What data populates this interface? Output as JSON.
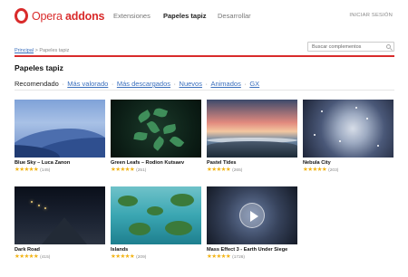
{
  "header": {
    "logo_part1": "Opera ",
    "logo_part2": "addons",
    "nav": [
      "Extensiones",
      "Papeles tapiz",
      "Desarrollar"
    ],
    "login": "INICIAR SESIÓN"
  },
  "breadcrumb": {
    "home": "Principal",
    "sep": " > ",
    "current": "Papeles tapiz"
  },
  "search": {
    "placeholder": "Buscar complementos"
  },
  "page_title": "Papeles tapiz",
  "tabs": [
    "Recomendado",
    "Más valorado",
    "Más descargados",
    "Nuevos",
    "Animados",
    "GX"
  ],
  "tab_separator": "·",
  "accent_color": "#d92b2b",
  "link_color": "#3a6fbd",
  "star_color": "#f2b417",
  "cards": [
    {
      "title": "Blue Sky – Luca Zanon",
      "stars": "★★★★★",
      "count": "(145)"
    },
    {
      "title": "Green Leafs – Rodion Kutsaev",
      "stars": "★★★★★",
      "count": "(251)"
    },
    {
      "title": "Pastel Tides",
      "stars": "★★★★★",
      "count": "(265)"
    },
    {
      "title": "Nebula City",
      "stars": "★★★★★",
      "count": "(203)"
    },
    {
      "title": "Dark Road",
      "stars": "★★★★★",
      "count": "(415)"
    },
    {
      "title": "Islands",
      "stars": "★★★★★",
      "count": "(209)"
    },
    {
      "title": "Mass Effect 3 - Earth Under Siege",
      "stars": "★★★★★",
      "count": "(1726)"
    }
  ]
}
